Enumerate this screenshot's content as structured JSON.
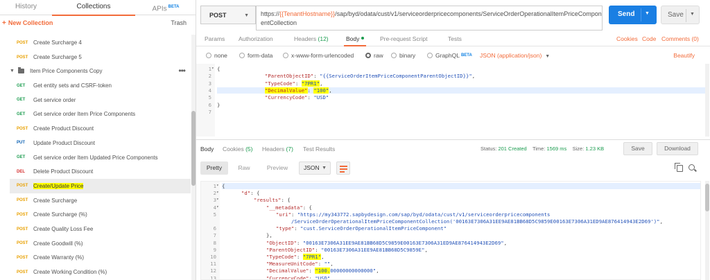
{
  "sidebar": {
    "tabs": [
      {
        "label": "History"
      },
      {
        "label": "Collections"
      },
      {
        "label": "APIs",
        "badge": "BETA"
      }
    ],
    "new_collection": "New Collection",
    "trash": "Trash",
    "folder": "Item Price Components Copy",
    "items_before": [
      {
        "method": "POST",
        "name": "Create Surcharge 4"
      },
      {
        "method": "POST",
        "name": "Create Surcharge 5"
      }
    ],
    "items": [
      {
        "method": "GET",
        "name": "Get entity sets and CSRF-token"
      },
      {
        "method": "GET",
        "name": "Get service order"
      },
      {
        "method": "GET",
        "name": "Get service order Item Price Components"
      },
      {
        "method": "POST",
        "name": "Create Product Discount"
      },
      {
        "method": "PUT",
        "name": "Update Product Discount"
      },
      {
        "method": "GET",
        "name": "Get service order Item Updated Price Components"
      },
      {
        "method": "DEL",
        "name": "Delete Product Discount"
      },
      {
        "method": "POST",
        "name": "Create/Update Price"
      },
      {
        "method": "POST",
        "name": "Create Surcharge"
      },
      {
        "method": "POST",
        "name": "Create Surcharge (%)"
      },
      {
        "method": "POST",
        "name": "Create Quality Loss Fee"
      },
      {
        "method": "POST",
        "name": "Create Goodwill (%)"
      },
      {
        "method": "POST",
        "name": "Create Warranty (%)"
      },
      {
        "method": "POST",
        "name": "Create Working Condition (%)"
      }
    ]
  },
  "request": {
    "method": "POST",
    "url_prefix": "https://",
    "url_env": "{{TenantHostname}}",
    "url_line1_rest": "/sap/byd/odata/cust/v1/serviceorderpricecomponents/ServiceOrderOperationalItemPriceCompon",
    "url_line2": "entCollection",
    "send_label": "Send",
    "save_label": "Save",
    "tabs": [
      {
        "label": "Params"
      },
      {
        "label": "Authorization"
      },
      {
        "label": "Headers",
        "count": "(12)"
      },
      {
        "label": "Body"
      },
      {
        "label": "Pre-request Script"
      },
      {
        "label": "Tests"
      }
    ],
    "links": {
      "cookies": "Cookies",
      "code": "Code",
      "comments": "Comments (0)"
    },
    "body_types": [
      "none",
      "form-data",
      "x-www-form-urlencoded",
      "raw",
      "binary",
      "GraphQL"
    ],
    "graphql_badge": "BETA",
    "content_type": "JSON (application/json)",
    "beautify": "Beautify",
    "body_lines": [
      {
        "n": "1",
        "fold": "▾",
        "text": "{"
      },
      {
        "n": "2",
        "key": "\"ParentObjectID\"",
        "val": "\"{{ServiceOrderItemPriceComponentParentObjectID}}\"",
        "tail": ","
      },
      {
        "n": "3",
        "key": "\"TypeCode\"",
        "val": "\"7PR1\"",
        "tail": ",",
        "hl": "val"
      },
      {
        "n": "4",
        "key": "\"DecimalValue\"",
        "val": "\"100\"",
        "tail": ",",
        "hl": "both",
        "cur": true
      },
      {
        "n": "5",
        "key": "\"CurrencyCode\"",
        "val": "\"USD\"",
        "tail": ""
      },
      {
        "n": "6",
        "text": "}"
      },
      {
        "n": "7",
        "text": ""
      }
    ]
  },
  "response": {
    "tabs": [
      {
        "label": "Body"
      },
      {
        "label": "Cookies",
        "count": "(5)"
      },
      {
        "label": "Headers",
        "count": "(7)"
      },
      {
        "label": "Test Results"
      }
    ],
    "status_label": "Status:",
    "status_value": "201 Created",
    "time_label": "Time:",
    "time_value": "1569 ms",
    "size_label": "Size:",
    "size_value": "1.23 KB",
    "save": "Save",
    "download": "Download",
    "views": [
      "Pretty",
      "Raw",
      "Preview"
    ],
    "format": "JSON",
    "lines": [
      {
        "n": "1",
        "fold": "▾",
        "ind": 0,
        "text": "{"
      },
      {
        "n": "2",
        "fold": "▾",
        "ind": 1,
        "key": "\"d\"",
        "text": ": {"
      },
      {
        "n": "3",
        "fold": "▾",
        "ind": 2,
        "key": "\"results\"",
        "text": ": {"
      },
      {
        "n": "4",
        "fold": "▾",
        "ind": 3,
        "key": "\"__metadata\"",
        "text": ": {"
      },
      {
        "n": "5",
        "ind": 4,
        "key": "\"uri\"",
        "val": "\"https://my343772.sapbydesign.com/sap/byd/odata/cust/v1/serviceorderpricecomponents"
      },
      {
        "n": "",
        "ind": 5,
        "val": "/ServiceOrderOperationalItemPriceComponentCollection('00163E7306A31EE9AE81BB68D5C9859E00163E7306A31ED9AE876414943E2D69')\"",
        "tail": ","
      },
      {
        "n": "6",
        "ind": 4,
        "key": "\"type\"",
        "val": "\"cust.ServiceOrderOperationalItemPriceComponent\""
      },
      {
        "n": "7",
        "ind": 3,
        "text": "},"
      },
      {
        "n": "8",
        "ind": 3,
        "key": "\"ObjectID\"",
        "val": "\"00163E7306A31EE9AE81BB68D5C9859E00163E7306A31ED9AE876414943E2D69\"",
        "tail": ","
      },
      {
        "n": "9",
        "ind": 3,
        "key": "\"ParentObjectID\"",
        "val": "\"00163E7306A31EE9AE81BB68D5C9859E\"",
        "tail": ","
      },
      {
        "n": "10",
        "ind": 3,
        "key": "\"TypeCode\"",
        "val": "\"7PR1\"",
        "tail": ",",
        "hl": "val"
      },
      {
        "n": "11",
        "ind": 3,
        "key": "\"MeasureUnitCode\"",
        "val": "\"\"",
        "tail": ","
      },
      {
        "n": "12",
        "ind": 3,
        "key": "\"DecimalValue\"",
        "val": "\"100.00000000000000\"",
        "tail": ",",
        "hl": "valpart"
      },
      {
        "n": "13",
        "ind": 3,
        "key": "\"CurrencyCode\"",
        "val": "\"USD\"",
        "tail": ","
      }
    ]
  },
  "colors": {
    "accent": "#f26b3a",
    "send": "#1a7fe3",
    "highlight": "#ffff00",
    "get": "#1b9c4f",
    "post": "#e8a000"
  }
}
